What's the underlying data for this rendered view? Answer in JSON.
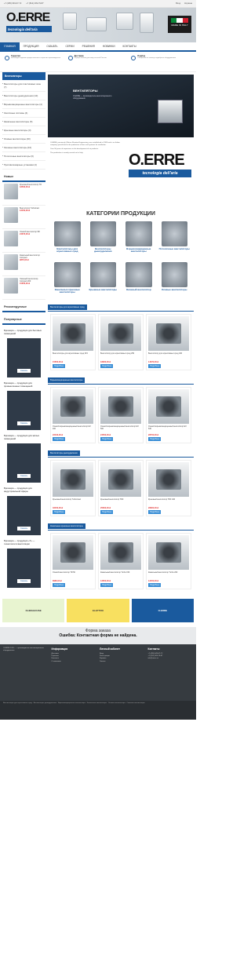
{
  "topbar": {
    "phone1": "+7 (495) 649-67-72",
    "phone2": "+7 (812) 409-79-87",
    "login": "Вход",
    "cart": "Корзина"
  },
  "brand": {
    "name": "O.ERRE",
    "tag": "tecnologia dell'aria",
    "made": "MADE IN ITALY"
  },
  "nav": [
    "Главная",
    "Продукция",
    "Скачать",
    "Серии",
    "Решения",
    "Новинки",
    "Контакты"
  ],
  "adv": [
    {
      "t": "Гарантия",
      "d": "На каждое изделие предоставляется гарантия производителя"
    },
    {
      "t": "Доставка",
      "d": "Осуществляем доставку по всей России"
    },
    {
      "t": "Подбор",
      "d": "Специалисты помогут подобрать оборудование"
    }
  ],
  "side": {
    "head": "Вентиляторы",
    "cats": [
      "Вентиляторы для пластиковых окон (7)",
      "Вентиляторы дымоудаления (10)",
      "Взрывозащищенные вентиляторы (4)",
      "Зонтичные системы (4)",
      "Канальные вентиляторы (5)",
      "Крышные вентиляторы (3)",
      "Осевые вентиляторы (20)",
      "Оконные вентиляторы (10)",
      "Потолочные вентиляторы (6)",
      "Противопожарные установки (2)"
    ],
    "newTitle": "Новые",
    "new": [
      {
        "n": "Крышный вентилятор TR",
        "p": "18500,00 ₽"
      },
      {
        "n": "Вентилятор Turbomaxi",
        "p": "12450,00 ₽"
      },
      {
        "n": "Осевой вентилятор SB",
        "p": "24670,00 ₽"
      },
      {
        "n": "Канальный вентилятор Compact",
        "p": "9870,00 ₽"
      },
      {
        "n": "Оконный вентилятор Compact 200",
        "p": "15650,00 ₽"
      }
    ],
    "recTitle": "Рекомендуемые",
    "popTitle": "Популярные",
    "brochures": [
      {
        "t": "Брошюра — продукция для бытовых помещений"
      },
      {
        "t": "Брошюра — продукция для промышленных помещений"
      },
      {
        "t": "Брошюра — продукция для жилых помещений"
      },
      {
        "t": "Брошюра — продукция для индустриальной сферы"
      },
      {
        "t": "Брошюра — продукция «Т» — технологии в вентиляции"
      }
    ],
    "bbtn": "Скачать"
  },
  "slider": {
    "title": "ВЕНТИЛЯТОРЫ",
    "desc": "O.ERRE — производитель вентиляционного оборудования"
  },
  "about": [
    "O.ERRE, previously Officine Riunitae Engineering, was established in 1969 and is an Italian company specialised in the production of fans and systems for ventilation.",
    "Over 50 years of experience in the development of air products.",
    "The production is mainly carried out in Italy."
  ],
  "catTitle": "КАТЕГОРИИ ПРОДУКЦИИ",
  "cats": [
    "Вентиляторы для агрессивных сред",
    "Вентиляторы дымоудаления",
    "Взрывозащищенные вентиляторы",
    "Потолочные вентиляторы",
    "Канальные крышные вентиляторы",
    "Крышные вентиляторы",
    "Оконный вентилятор",
    "Осевые вентиляторы"
  ],
  "sections": [
    {
      "title": "Вентиляторы для агрессивных сред",
      "prods": [
        {
          "n": "Вентиляторы для агрессивных сред 315",
          "p": "15650,00 ₽"
        },
        {
          "n": "Вентилятор для агрессивных сред 250",
          "p": "18900,00 ₽"
        },
        {
          "n": "Вентилятор для агрессивных сред 400",
          "p": "14670,00 ₽"
        }
      ]
    },
    {
      "title": "Взрывозащищенные вентиляторы",
      "prods": [
        {
          "n": "Осевой взрывозащищенный вентилятор ЕХ 400",
          "p": "22340,00 ₽"
        },
        {
          "n": "Осевой взрывозащищенный вентилятор ЕХ 500",
          "p": "24500,00 ₽"
        },
        {
          "n": "Осевой взрывозащищенный вентилятор ЕХ 630",
          "p": "28700,00 ₽"
        }
      ]
    },
    {
      "title": "Вентиляторы дымоудаления",
      "prods": [
        {
          "n": "Крышный вентилятор Turbomaxi",
          "p": "32450,00 ₽"
        },
        {
          "n": "Крышный вентилятор TRF",
          "p": "25600,00 ₽"
        },
        {
          "n": "Крышный вентилятор TRF 400",
          "p": "28900,00 ₽"
        }
      ]
    },
    {
      "title": "Канальные крышные вентиляторы",
      "prods": [
        {
          "n": "Осевой вентилятор TR 50",
          "p": "8980,00 ₽"
        },
        {
          "n": "Канальный вентилятор Turbo 150",
          "p": "12650,00 ₽"
        },
        {
          "n": "Канальный вентилятор Turbo 200",
          "p": "13450,00 ₽"
        }
      ]
    }
  ],
  "btn": "Подробнее",
  "partners": [
    "KLIMAHOUSE",
    "ELETTRO",
    "O.ERRE"
  ],
  "form": {
    "a": "Форма заказа",
    "b": "Ошибка: Контактная форма не найдена."
  },
  "footer": {
    "about": "O.ERRE S.R.L. — производитель вентиляционного оборудования",
    "cols": [
      {
        "h": "Информация",
        "items": [
          "Доставка",
          "Гарантия",
          "Контакты",
          "О компании"
        ]
      },
      {
        "h": "Личный кабинет",
        "items": [
          "Вход",
          "Регистрация",
          "Корзина",
          "Заказы"
        ]
      },
      {
        "h": "Контакты",
        "items": [
          "+7 (495) 649-67-72",
          "+7 (812) 409-79-87",
          "info@oerre.ru"
        ]
      }
    ]
  },
  "bottom": "Вентиляторы для агрессивных сред · Вентиляторы дымоудаления · Взрывозащищенные вентиляторы · Канальные вентиляторы · Осевые вентиляторы · Оконные вентиляторы"
}
